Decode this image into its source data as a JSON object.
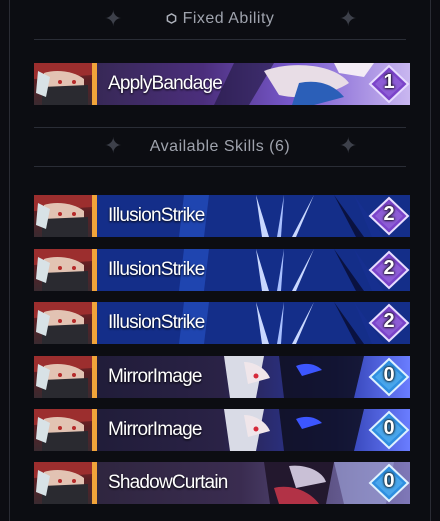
{
  "fixed_section": {
    "title": "Fixed Ability"
  },
  "fixed_skills": [
    {
      "name": "ApplyBandage",
      "cost": "1",
      "cost_color": "#7b43c9"
    }
  ],
  "available_section": {
    "title": "Available Skills (6)"
  },
  "available_skills": [
    {
      "name": "IllusionStrike",
      "cost": "2",
      "cost_color": "#7b43c9"
    },
    {
      "name": "IllusionStrike",
      "cost": "2",
      "cost_color": "#7b43c9"
    },
    {
      "name": "IllusionStrike",
      "cost": "2",
      "cost_color": "#7b43c9"
    },
    {
      "name": "MirrorImage",
      "cost": "0",
      "cost_color": "#2f8fe0"
    },
    {
      "name": "MirrorImage",
      "cost": "0",
      "cost_color": "#2f8fe0"
    },
    {
      "name": "ShadowCurtain",
      "cost": "0",
      "cost_color": "#2f8fe0"
    }
  ],
  "colors": {
    "accent_bar": "#f1a43a",
    "cost_purple": "#7b43c9",
    "cost_blue": "#2f8fe0"
  }
}
